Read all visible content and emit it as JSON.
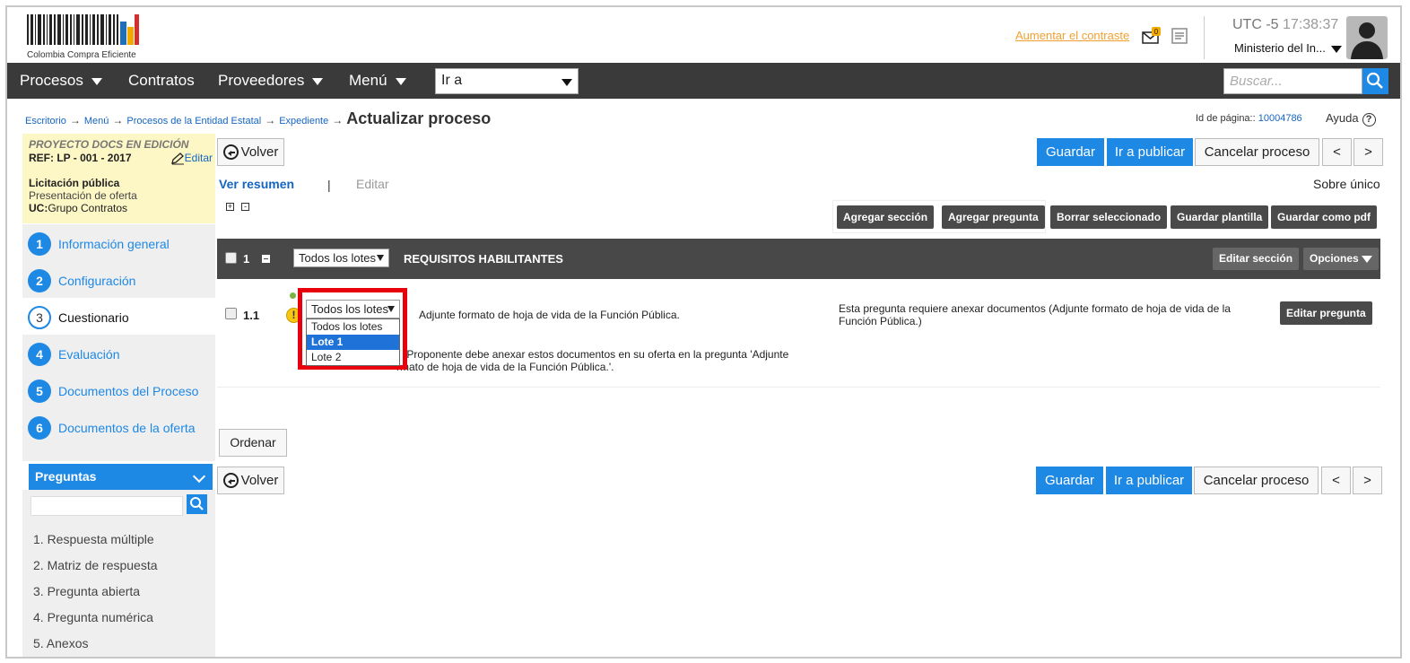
{
  "header": {
    "logo_text": "Colombia Compra Eficiente",
    "contrast_link": "Aumentar el contraste",
    "notif_count": "0",
    "timezone": "UTC -5",
    "time": "17:38:37",
    "entity": "Ministerio del In..."
  },
  "nav": {
    "procesos": "Procesos",
    "contratos": "Contratos",
    "proveedores": "Proveedores",
    "menu": "Menú",
    "goto_value": "Ir a",
    "search_placeholder": "Buscar..."
  },
  "breadcrumb": {
    "items": [
      "Escritorio",
      "Menú",
      "Procesos de la Entidad Estatal",
      "Expediente"
    ],
    "current": "Actualizar proceso"
  },
  "page_id": {
    "label": "Id de página::",
    "value": "10004786",
    "help": "Ayuda",
    "help_icon": "?"
  },
  "project": {
    "title": "PROYECTO DOCS EN EDICIÓN",
    "ref": "REF: LP - 001 - 2017",
    "edit": "Editar",
    "type": "Licitación pública",
    "stage": "Presentación de oferta",
    "uc_label": "UC:",
    "uc_value": "Grupo Contratos"
  },
  "steps": [
    {
      "num": "1",
      "label": "Información general"
    },
    {
      "num": "2",
      "label": "Configuración"
    },
    {
      "num": "3",
      "label": "Cuestionario"
    },
    {
      "num": "4",
      "label": "Evaluación"
    },
    {
      "num": "5",
      "label": "Documentos del Proceso"
    },
    {
      "num": "6",
      "label": "Documentos de la oferta"
    }
  ],
  "preguntas": {
    "title": "Preguntas",
    "items": [
      "1.  Respuesta múltiple",
      "2.  Matriz de respuesta",
      "3.  Pregunta abierta",
      "4.  Pregunta numérica",
      "5.  Anexos"
    ]
  },
  "toolbar": {
    "volver": "Volver",
    "guardar": "Guardar",
    "publicar": "Ir a publicar",
    "cancelar": "Cancelar proceso",
    "prev": "<",
    "next": ">",
    "ordenar": "Ordenar"
  },
  "tabs": {
    "resumen": "Ver resumen",
    "separator": "|",
    "editar": "Editar",
    "sobre": "Sobre único",
    "expand": "+",
    "collapse": "-"
  },
  "section_actions": {
    "agregar_seccion": "Agregar sección",
    "agregar_pregunta": "Agregar pregunta",
    "borrar": "Borrar seleccionado",
    "guardar_plantilla": "Guardar plantilla",
    "guardar_pdf": "Guardar como pdf"
  },
  "section": {
    "num": "1",
    "lot_value": "Todos los lotes",
    "title": "REQUISITOS HABILITANTES",
    "edit": "Editar sección",
    "options": "Opciones"
  },
  "question": {
    "num": "1.1",
    "warning": "!",
    "lot_value": "Todos los lotes",
    "lot_options": [
      "Todos los lotes",
      "Lote 1",
      "Lote 2"
    ],
    "lot_selected_index": 1,
    "text": "Adjunte formato de hoja de vida de la Función Pública.",
    "note_line1": "E Proponente debe anexar estos documentos en su oferta en la pregunta 'Adjunte",
    "note_line2": "rmato de hoja de vida de la Función Pública.'.",
    "requirement": "Esta pregunta requiere anexar documentos (Adjunte formato de hoja de vida de la Función Pública.)",
    "edit": "Editar pregunta"
  }
}
